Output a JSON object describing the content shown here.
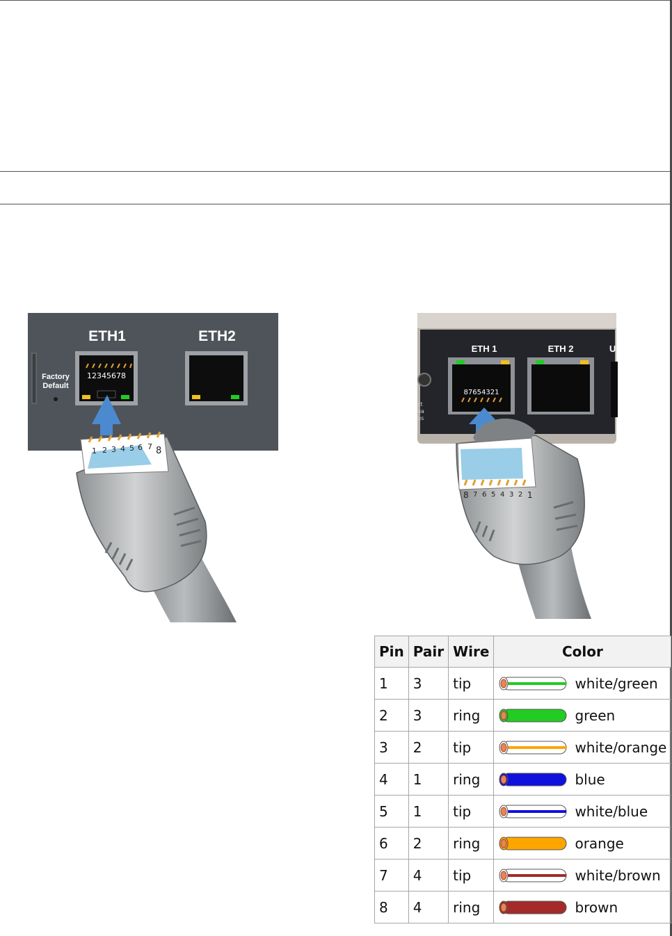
{
  "figure_left": {
    "ports": [
      "ETH1",
      "ETH2"
    ],
    "button_label_1": "Factory",
    "button_label_2": "Default",
    "jack_pins": "12345678",
    "plug_pins": [
      "1",
      "2",
      "3",
      "4",
      "5",
      "6",
      "7",
      "8"
    ]
  },
  "figure_right": {
    "ports": [
      "ETH 1",
      "ETH 2",
      "U"
    ],
    "side_text": [
      "ct",
      "ea",
      "us"
    ],
    "jack_pins": "87654321",
    "plug_pins": [
      "8",
      "7",
      "6",
      "5",
      "4",
      "3",
      "2",
      "1"
    ]
  },
  "table": {
    "headers": [
      "Pin",
      "Pair",
      "Wire",
      "Color"
    ],
    "rows": [
      {
        "pin": "1",
        "pair": "3",
        "wire": "tip",
        "color": "white/green",
        "main": "#22cc22",
        "striped": true
      },
      {
        "pin": "2",
        "pair": "3",
        "wire": "ring",
        "color": "green",
        "main": "#22cc22",
        "striped": false
      },
      {
        "pin": "3",
        "pair": "2",
        "wire": "tip",
        "color": "white/orange",
        "main": "#ffa500",
        "striped": true
      },
      {
        "pin": "4",
        "pair": "1",
        "wire": "ring",
        "color": "blue",
        "main": "#1111dd",
        "striped": false
      },
      {
        "pin": "5",
        "pair": "1",
        "wire": "tip",
        "color": "white/blue",
        "main": "#1111dd",
        "striped": true
      },
      {
        "pin": "6",
        "pair": "2",
        "wire": "ring",
        "color": "orange",
        "main": "#ffa500",
        "striped": false
      },
      {
        "pin": "7",
        "pair": "4",
        "wire": "tip",
        "color": "white/brown",
        "main": "#a52a2a",
        "striped": true
      },
      {
        "pin": "8",
        "pair": "4",
        "wire": "ring",
        "color": "brown",
        "main": "#a52a2a",
        "striped": false
      }
    ]
  }
}
